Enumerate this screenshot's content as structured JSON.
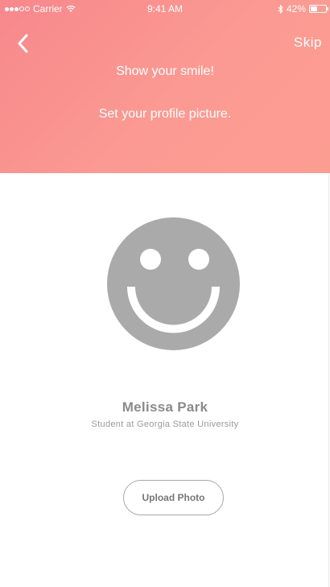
{
  "status_bar": {
    "carrier": "Carrier",
    "time": "9:41 AM",
    "battery_text": "42%",
    "battery_level": 0.42,
    "icons": [
      "signal-dots-icon",
      "wifi-icon",
      "bluetooth-icon",
      "battery-icon"
    ]
  },
  "nav": {
    "back_icon": "chevron-left-icon",
    "skip_label": "Skip"
  },
  "header": {
    "line1": "Show your smile!",
    "line2": "Set your profile picture."
  },
  "profile": {
    "avatar_icon": "smiley-placeholder-icon",
    "name": "Melissa Park",
    "subtitle": "Student at Georgia State University"
  },
  "actions": {
    "upload_label": "Upload Photo"
  },
  "colors": {
    "header_gradient_start": "#f7888c",
    "header_gradient_end": "#fc9d92",
    "avatar_gray": "#aaaaaa",
    "text_gray": "#8a8a8a"
  }
}
